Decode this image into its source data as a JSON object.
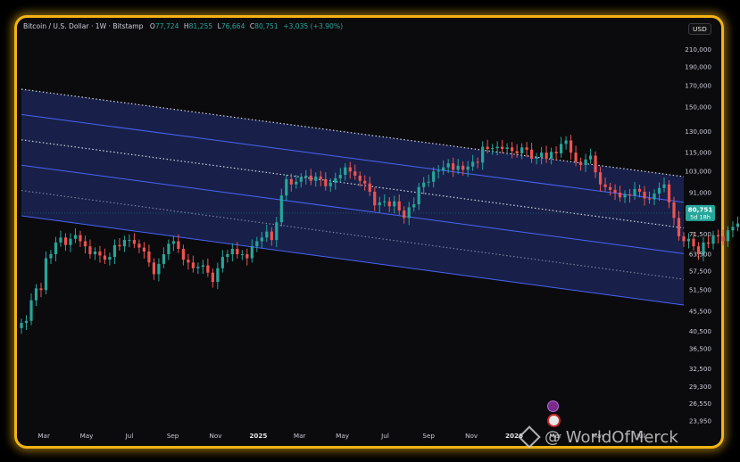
{
  "header": {
    "symbol": "Bitcoin / U.S. Dollar · 1W · Bitstamp",
    "o_label": "O",
    "o_value": "77,724",
    "h_label": "H",
    "h_value": "81,255",
    "l_label": "L",
    "l_value": "76,664",
    "c_label": "C",
    "c_value": "80,751",
    "change": "+3,035 (+3.90%)"
  },
  "currency": "USD",
  "price_tag": {
    "price": "80,751",
    "countdown": "5d 18h"
  },
  "watermark": "@ WorldOfMerck",
  "colors": {
    "up": "#26a69a",
    "down": "#ef5350",
    "channel": "#3d5afe",
    "frame": "#f2b316",
    "background": "#0b0b0e"
  },
  "chart_data": {
    "type": "candlestick",
    "y_scale": "log",
    "ylim": [
      22500,
      240000
    ],
    "y_ticks": [
      "210,000",
      "190,000",
      "170,000",
      "150,000",
      "130,000",
      "115,000",
      "103,000",
      "91,000",
      "81,000",
      "71,500",
      "63,500",
      "57,500",
      "51,500",
      "45,500",
      "40,500",
      "36,500",
      "32,500",
      "29,300",
      "26,550",
      "23,950"
    ],
    "y_tick_values": [
      210000,
      190000,
      170000,
      150000,
      130000,
      115000,
      103000,
      91000,
      81000,
      71500,
      63500,
      57500,
      51500,
      45500,
      40500,
      36500,
      32500,
      29300,
      26550,
      23950
    ],
    "x_range": [
      "2024-01-29",
      "2026-08-31"
    ],
    "x_ticks": [
      {
        "label": "Mar",
        "date": "2024-03-01"
      },
      {
        "label": "May",
        "date": "2024-05-01"
      },
      {
        "label": "Jul",
        "date": "2024-07-01"
      },
      {
        "label": "Sep",
        "date": "2024-09-01"
      },
      {
        "label": "Nov",
        "date": "2024-11-01"
      },
      {
        "label": "2025",
        "date": "2025-01-01"
      },
      {
        "label": "Mar",
        "date": "2025-03-01"
      },
      {
        "label": "May",
        "date": "2025-05-01"
      },
      {
        "label": "Jul",
        "date": "2025-07-01"
      },
      {
        "label": "Sep",
        "date": "2025-09-01"
      },
      {
        "label": "Nov",
        "date": "2025-11-01"
      },
      {
        "label": "2026",
        "date": "2026-01-01"
      },
      {
        "label": "Mar",
        "date": "2026-03-01"
      },
      {
        "label": "May",
        "date": "2026-05-01"
      },
      {
        "label": "Jul",
        "date": "2026-07-01"
      }
    ],
    "first_week": "2024-01-29",
    "closes": [
      42500,
      43000,
      48500,
      52000,
      51500,
      62000,
      63500,
      68000,
      70000,
      67000,
      69500,
      71000,
      68500,
      66500,
      63500,
      64500,
      63000,
      61500,
      62500,
      67000,
      66500,
      69000,
      69000,
      67500,
      66000,
      64500,
      60500,
      56500,
      60000,
      63500,
      67500,
      68500,
      65500,
      61500,
      60500,
      58500,
      59000,
      59500,
      57000,
      54000,
      58500,
      62500,
      63500,
      65500,
      63500,
      63500,
      62000,
      66500,
      68500,
      70000,
      72500,
      69000,
      76500,
      89500,
      98500,
      95500,
      97000,
      99500,
      100500,
      97500,
      100000,
      98500,
      94500,
      96500,
      99000,
      101000,
      105500,
      103000,
      100500,
      97500,
      96000,
      91500,
      84500,
      86000,
      86500,
      84000,
      86500,
      82000,
      78500,
      83500,
      85000,
      94000,
      96500,
      97000,
      103000,
      103500,
      105500,
      108000,
      104000,
      106500,
      104000,
      106000,
      109000,
      108500,
      119000,
      117500,
      118000,
      119000,
      117500,
      118500,
      116000,
      114500,
      118500,
      117000,
      111000,
      112000,
      115000,
      111000,
      115500,
      114500,
      121000,
      123500,
      115000,
      109000,
      107000,
      110500,
      113000,
      102500,
      95500,
      94000,
      92500,
      91000,
      88500,
      90000,
      89500,
      93000,
      91500,
      88000,
      87500,
      90500,
      93500,
      95500,
      86000,
      78500,
      70500,
      68500,
      69500,
      66500,
      63500,
      68000,
      67500,
      71000,
      70500,
      68500,
      73000,
      74500,
      76000,
      77500,
      78500,
      81000,
      80500,
      76000,
      71500,
      68500,
      64000,
      64500,
      62000,
      62500,
      64000,
      63000,
      64000,
      64500,
      64000,
      63500,
      63000,
      77700,
      80751
    ]
  }
}
